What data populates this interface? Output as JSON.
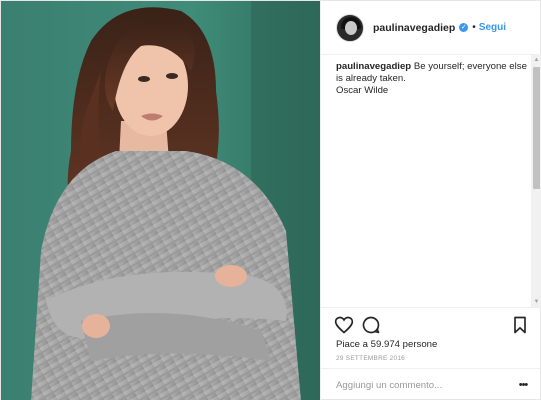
{
  "post": {
    "username": "paulinavegadiep",
    "verified": true,
    "separator": "•",
    "follow_label": "Segui",
    "caption": {
      "username": "paulinavegadiep",
      "text": "Be yourself; everyone else is already taken.",
      "author": "Oscar Wilde"
    },
    "likes_text": "Piace a 59.974 persone",
    "date": "29 SETTEMBRE 2016",
    "comment_placeholder": "Aggiungi un commento...",
    "more_label": "•••",
    "icons": [
      "heart-icon",
      "comment-icon",
      "bookmark-icon",
      "more-options-icon",
      "verified-badge-icon"
    ],
    "colors": {
      "accent": "#3897f0",
      "text": "#262626",
      "muted": "#999999",
      "photo_background": "#3e8a76"
    }
  }
}
